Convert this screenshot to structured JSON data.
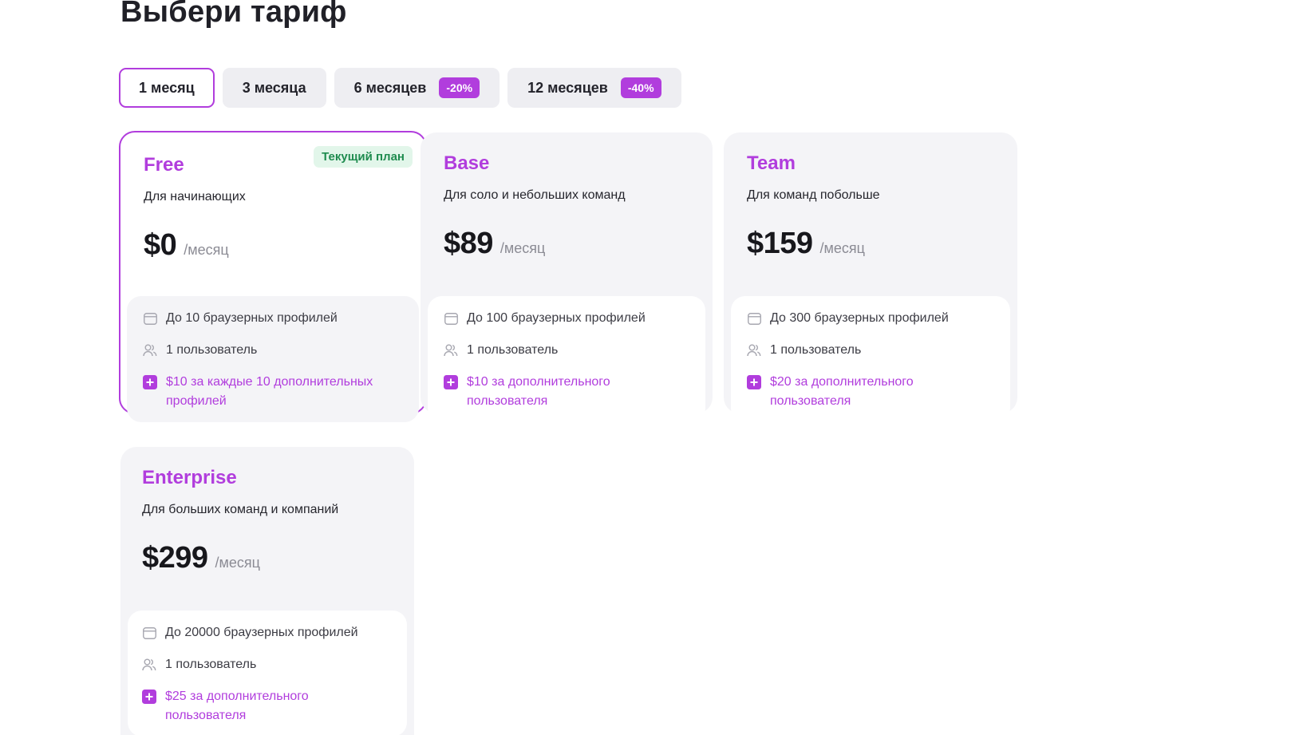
{
  "page": {
    "title": "Выбери тариф"
  },
  "period_tabs": [
    {
      "label": "1 месяц",
      "discount": "",
      "active": true
    },
    {
      "label": "3 месяца",
      "discount": "",
      "active": false
    },
    {
      "label": "6 месяцев",
      "discount": "-20%",
      "active": false
    },
    {
      "label": "12 месяцев",
      "discount": "-40%",
      "active": false
    }
  ],
  "colors": {
    "accent": "#b13ddd",
    "card_bg": "#f4f4f7",
    "badge_bg": "#e2f6ea",
    "badge_text": "#1f8c4f"
  },
  "plans": [
    {
      "name": "Free",
      "description": "Для начинающих",
      "price": "$0",
      "per": "/месяц",
      "badge": "Текущий план",
      "features": [
        {
          "icon": "browser-icon",
          "text": "До 10 браузерных профилей"
        },
        {
          "icon": "users-icon",
          "text": "1 пользователь"
        },
        {
          "icon": "plus-icon",
          "text": "$10 за каждые 10 дополнительных профилей",
          "line1": "$10 за каждые 10 дополнительных",
          "line2": "профилей"
        }
      ]
    },
    {
      "name": "Base",
      "description": "Для соло и небольших команд",
      "price": "$89",
      "per": "/месяц",
      "features": [
        {
          "icon": "browser-icon",
          "text": "До 100 браузерных профилей"
        },
        {
          "icon": "users-icon",
          "text": "1 пользователь"
        },
        {
          "icon": "plus-icon",
          "text": "$10 за дополнительного пользователя",
          "line1": "$10 за дополнительного",
          "line2": "пользователя"
        }
      ]
    },
    {
      "name": "Team",
      "description": "Для команд побольше",
      "price": "$159",
      "per": "/месяц",
      "features": [
        {
          "icon": "browser-icon",
          "text": "До 300 браузерных профилей"
        },
        {
          "icon": "users-icon",
          "text": "1 пользователь"
        },
        {
          "icon": "plus-icon",
          "text": "$20 за дополнительного пользователя",
          "line1": "$20 за дополнительного",
          "line2": "пользователя"
        }
      ]
    },
    {
      "name": "Enterprise",
      "description": "Для больших команд и компаний",
      "price": "$299",
      "per": "/месяц",
      "features": [
        {
          "icon": "browser-icon",
          "text": "До 20000 браузерных профилей"
        },
        {
          "icon": "users-icon",
          "text": "1 пользователь"
        },
        {
          "icon": "plus-icon",
          "text": "$25 за дополнительного пользователя",
          "line1": "$25 за дополнительного",
          "line2": "пользователя"
        }
      ]
    }
  ]
}
